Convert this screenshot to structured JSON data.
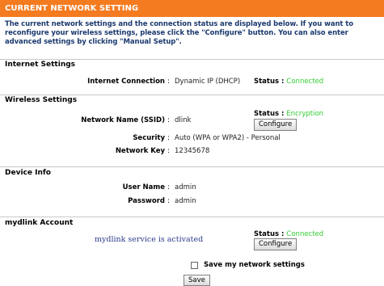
{
  "header": {
    "title": "CURRENT NETWORK SETTING"
  },
  "intro": {
    "text": "The current network settings and the connection status are displayed below. If you want to reconfigure your wireless settings, please click the \"Configure\" button. You can also enter advanced settings by clicking \"Manual Setup\"."
  },
  "internet": {
    "section_title": "Internet Settings",
    "connection_label": "Internet Connection",
    "connection_value": "Dynamic IP (DHCP)",
    "status_label": "Status :",
    "status_value": "Connected"
  },
  "wireless": {
    "section_title": "Wireless Settings",
    "ssid_label": "Network Name (SSID)",
    "ssid_value": "dlink",
    "status_label": "Status :",
    "status_value": "Encryption",
    "configure_label": "Configure",
    "security_label": "Security",
    "security_value": "Auto (WPA or WPA2) - Personal",
    "key_label": "Network Key",
    "key_value": "12345678"
  },
  "device": {
    "section_title": "Device Info",
    "user_label": "User Name",
    "user_value": "admin",
    "password_label": "Password",
    "password_value": "admin"
  },
  "mydlink": {
    "section_title": "mydlink Account",
    "message": "mydlink service is activated",
    "status_label": "Status :",
    "status_value": "Connected",
    "configure_label": "Configure"
  },
  "footer": {
    "save_checkbox_label": "Save my network settings",
    "save_button_label": "Save"
  },
  "separator": ":",
  "colors": {
    "header": "#f47b20",
    "status_green": "#33cc33",
    "intro_text": "#1b3a6f",
    "mydlink_text": "#2e3c8c"
  }
}
